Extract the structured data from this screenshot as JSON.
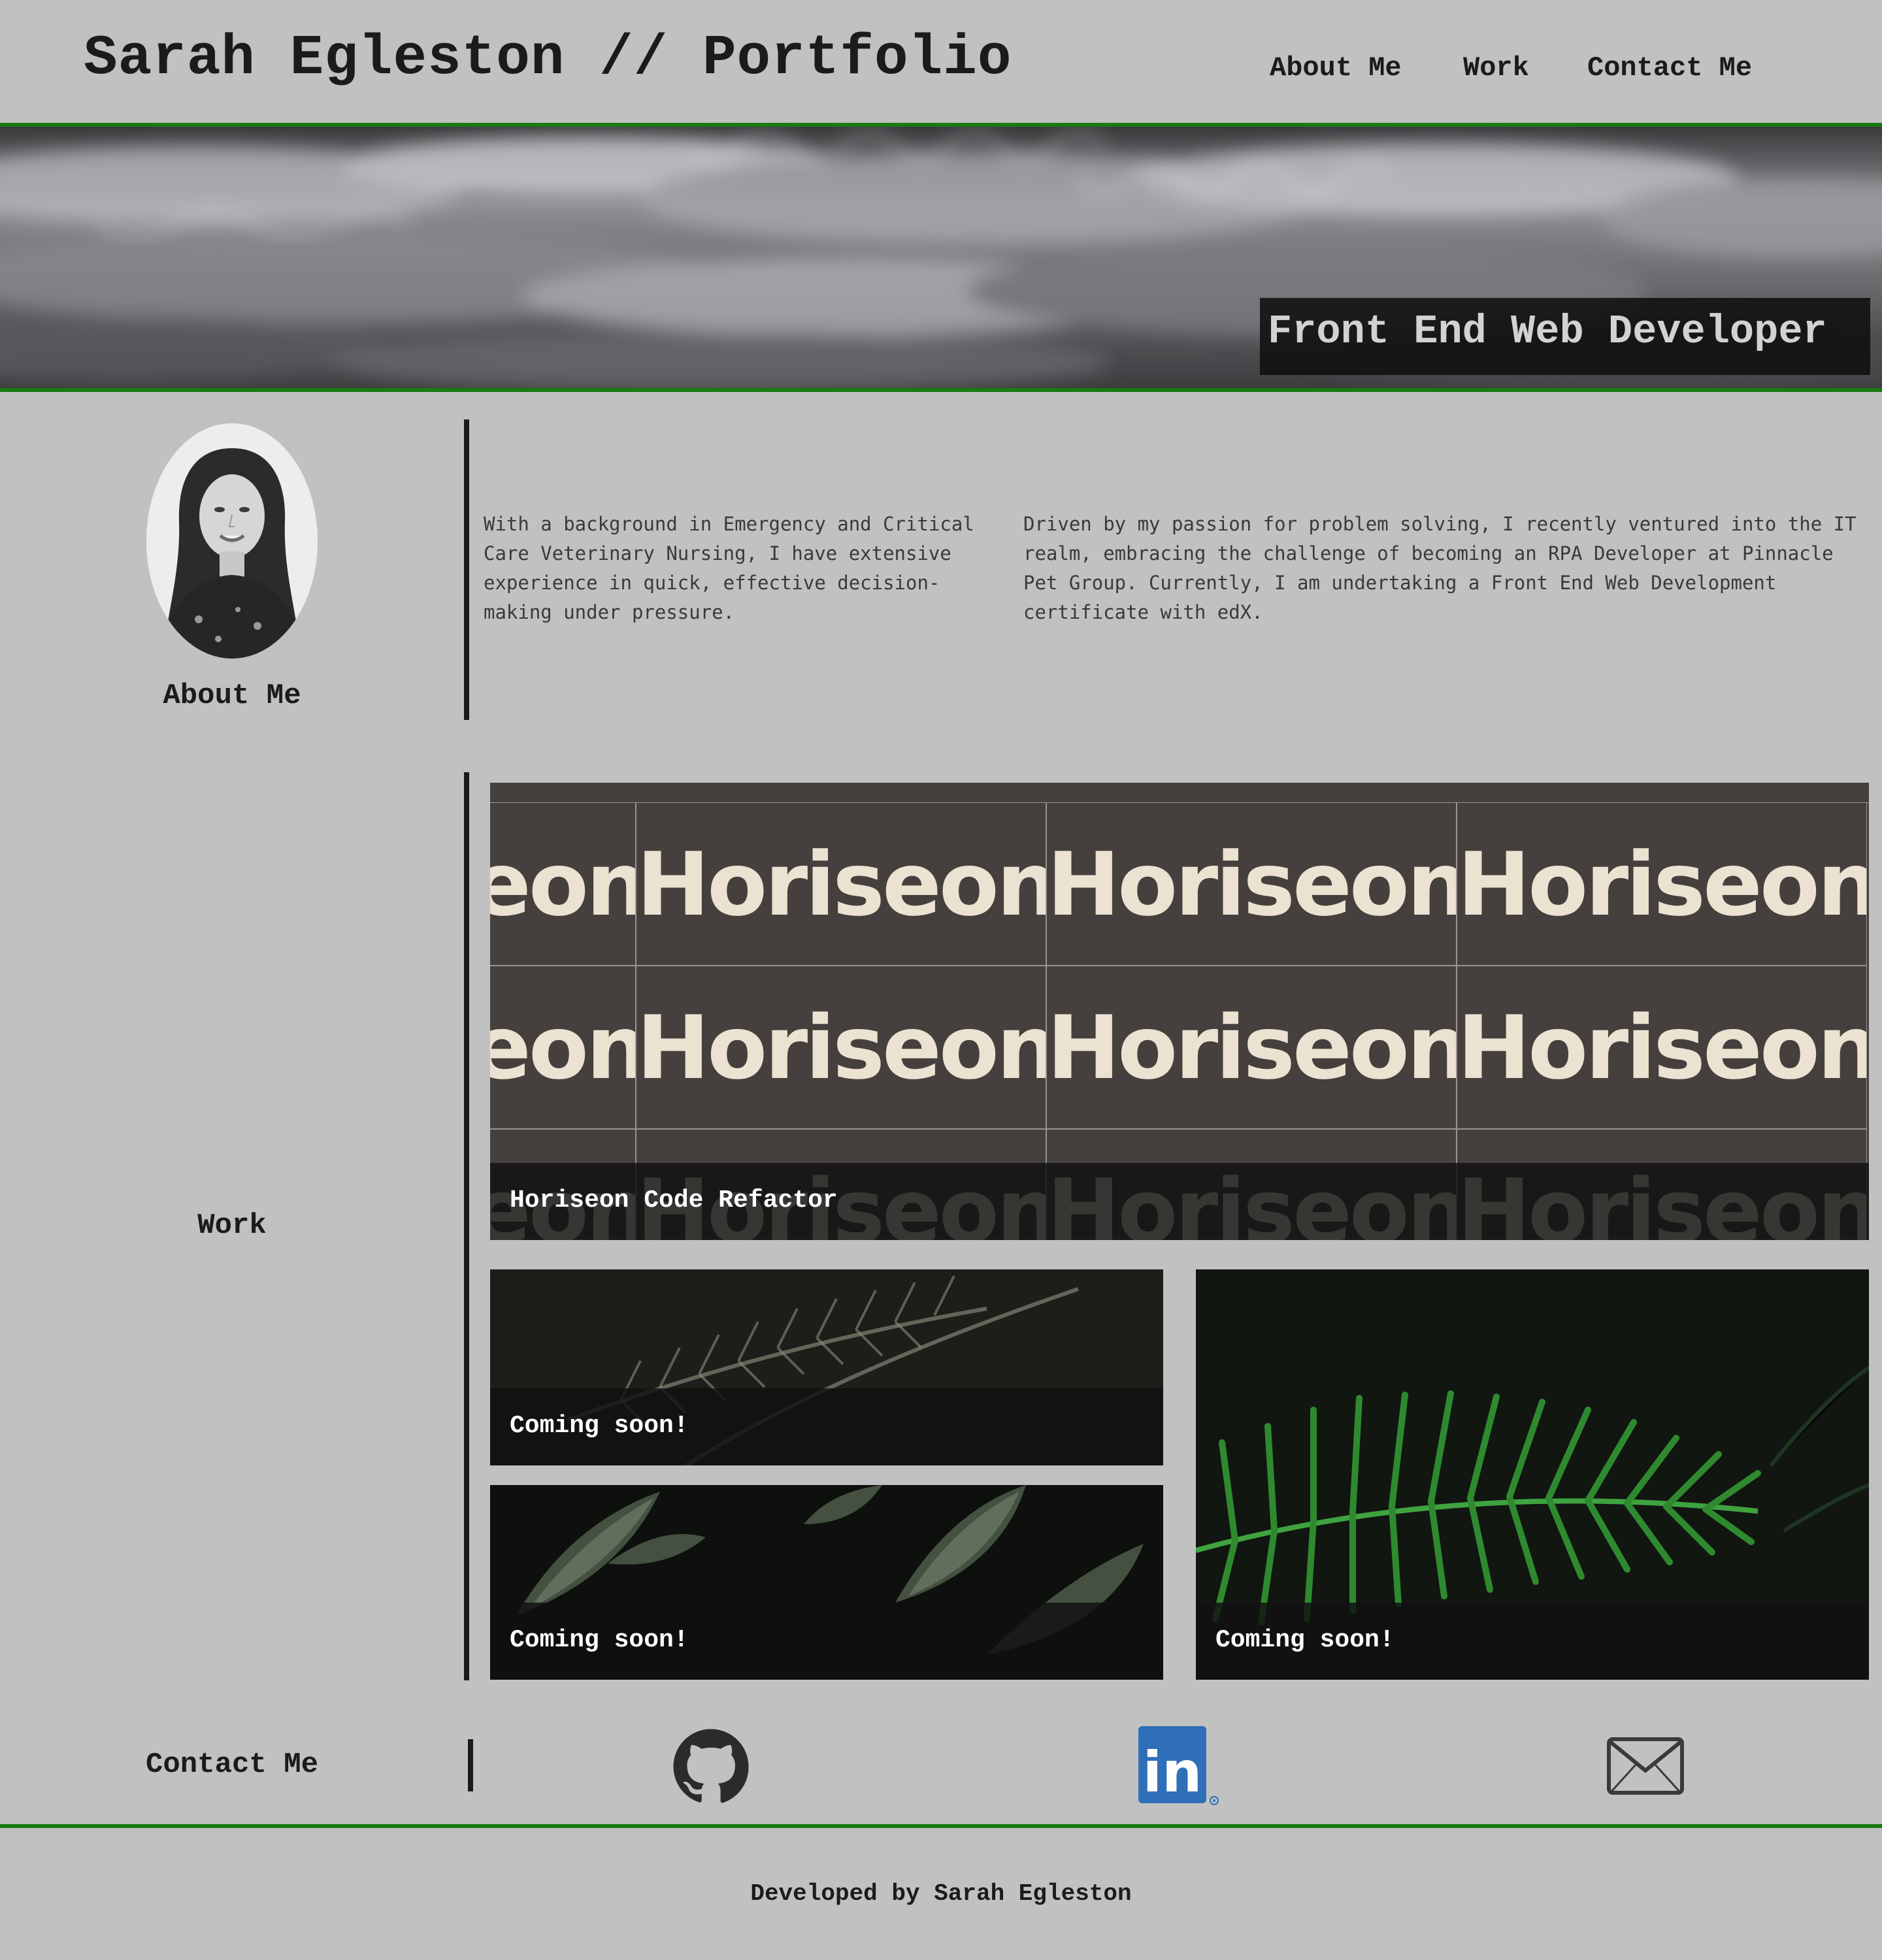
{
  "header": {
    "title": "Sarah Egleston // Portfolio",
    "nav": [
      {
        "label": "About Me"
      },
      {
        "label": "Work"
      },
      {
        "label": "Contact Me"
      }
    ]
  },
  "hero": {
    "tagline": "Front End Web Developer"
  },
  "about": {
    "heading": "About Me",
    "paragraphs": [
      "With a background in Emergency and Critical Care Veterinary Nursing, I have extensive experience in quick, effective decision-making under pressure.",
      "Driven by my passion for problem solving, I recently ventured into the IT realm, embracing the challenge of becoming an RPA Developer at Pinnacle Pet Group. Currently, I am undertaking a Front End Web Development certificate with edX."
    ]
  },
  "work": {
    "heading": "Work",
    "projects": [
      {
        "caption": "Horiseon Code Refactor",
        "image_text": "Horiseon"
      },
      {
        "caption": "Coming soon!"
      },
      {
        "caption": "Coming soon!"
      },
      {
        "caption": "Coming soon!"
      }
    ]
  },
  "contact": {
    "heading": "Contact Me",
    "links": [
      {
        "icon": "github-icon"
      },
      {
        "icon": "linkedin-icon",
        "label": "in"
      },
      {
        "icon": "mail-icon"
      }
    ]
  },
  "footer": {
    "credit": "Developed by Sarah Egleston"
  },
  "colors": {
    "background": "#c1c1c1",
    "accent_green": "#1a7a12",
    "text": "#1b1b1b",
    "linkedin_blue": "#2f6fb8"
  }
}
